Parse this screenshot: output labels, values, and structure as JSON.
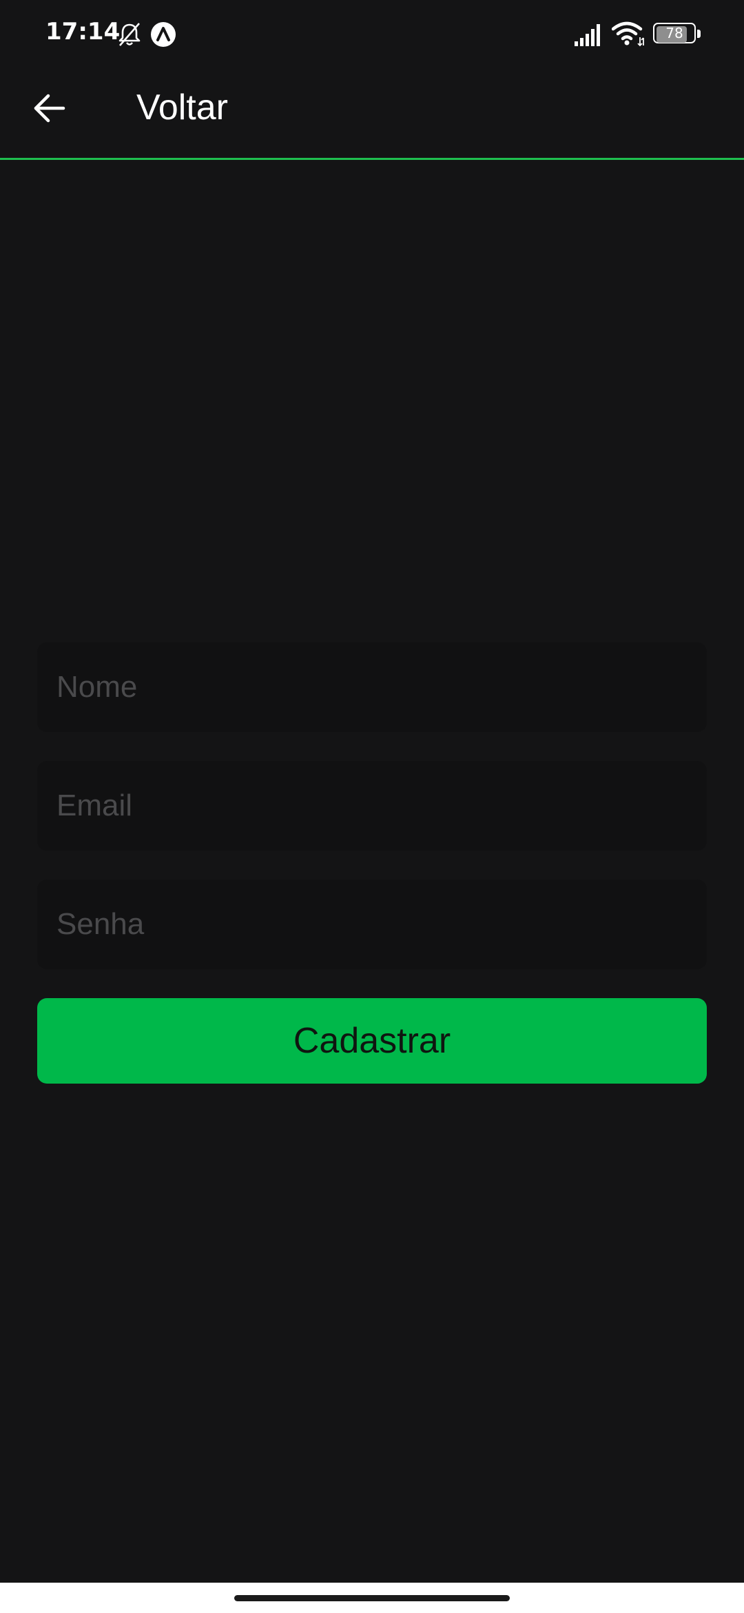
{
  "status_bar": {
    "time": "17:14",
    "battery_level": "78",
    "battery_percent": 78,
    "icons": [
      "bell-muted-icon",
      "app-notification-icon",
      "signal-icon",
      "wifi-icon",
      "battery-icon"
    ]
  },
  "header": {
    "back_icon": "arrow-left-icon",
    "title": "Voltar"
  },
  "form": {
    "name_placeholder": "Nome",
    "email_placeholder": "Email",
    "password_placeholder": "Senha",
    "submit_label": "Cadastrar"
  },
  "colors": {
    "background": "#141415",
    "accent": "#00b84a",
    "header_divider": "#1fbf4f",
    "input_background": "#111112",
    "placeholder": "#4a4a4c"
  }
}
